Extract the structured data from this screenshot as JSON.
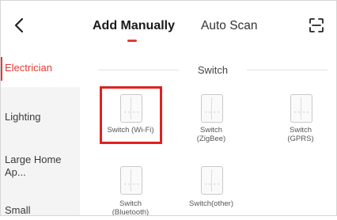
{
  "header": {
    "back_icon": "chevron-left-icon",
    "tabs": [
      {
        "label": "Add Manually",
        "active": true
      },
      {
        "label": "Auto Scan",
        "active": false
      }
    ],
    "scan_icon": "scan-frame-icon",
    "accent": "#e53935"
  },
  "sidebar": {
    "items": [
      {
        "label": "Electrician",
        "active": true
      },
      {
        "label": "Lighting"
      },
      {
        "label": "Large Home Ap..."
      },
      {
        "label": "Small"
      }
    ]
  },
  "section": {
    "title": "Switch"
  },
  "devices": [
    {
      "label": "Switch (Wi-Fi)",
      "highlighted": true
    },
    {
      "label": "Switch (ZigBee)"
    },
    {
      "label": "Switch (GPRS)"
    },
    {
      "label": "Switch (Bluetooth)"
    },
    {
      "label": "Switch(other)"
    }
  ]
}
